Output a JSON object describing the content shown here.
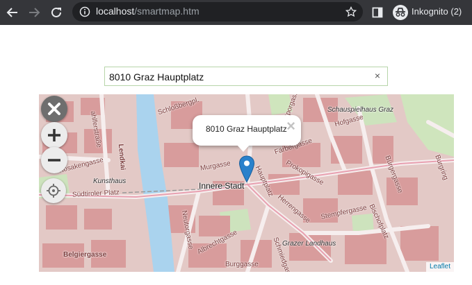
{
  "browser": {
    "url_host": "localhost",
    "url_path": "/smartmap.htm",
    "profile_label": "Inkognito (2)"
  },
  "search": {
    "value": "8010 Graz Hauptplatz",
    "clear_symbol": "×"
  },
  "map": {
    "popup_text": "8010 Graz Hauptplatz",
    "popup_close_symbol": "×",
    "place_label": "Innere Stadt",
    "attribution": "Leaflet",
    "streets": [
      "Schloßbergpl.",
      "ahlferstraße",
      "Lendkai",
      "Kosakengasse",
      "Kunsthaus",
      "Südtiroler Platz",
      "Murgasse",
      "Sporgasse",
      "Färbergasse",
      "Prokopigasse",
      "Herrengasse",
      "Stempfergasse",
      "Bischofplatz",
      "Bürgergasse",
      "Burgring",
      "Hofgasse",
      "Schauspielhaus Graz",
      "Neutorgasse",
      "Albrechtgasse",
      "Belgiergasse",
      "Grazer Landhaus",
      "Burggasse",
      "Schmiedgasse",
      "Hauptplatz"
    ]
  }
}
